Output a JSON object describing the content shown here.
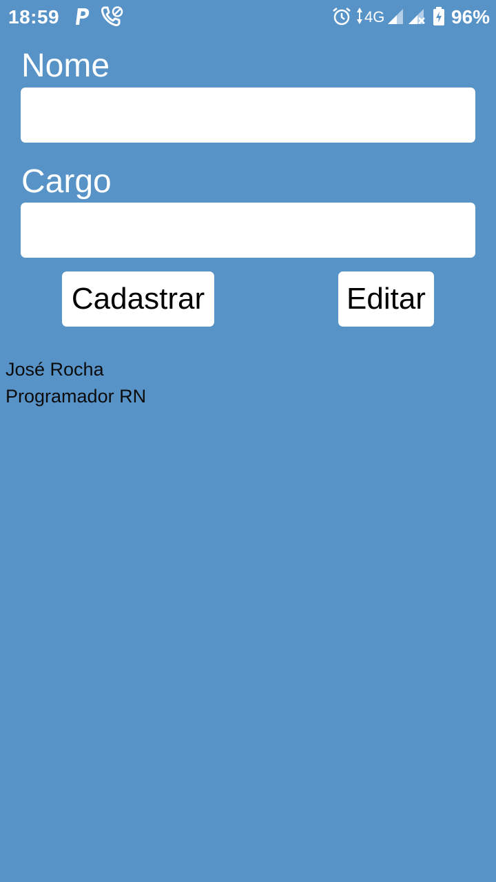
{
  "status_bar": {
    "time": "18:59",
    "network_type": "4G",
    "battery_percent": "96%",
    "icons": [
      "parking-p-icon",
      "call-blocked-icon",
      "alarm-icon",
      "data-arrows-icon",
      "signal-icon",
      "signal-no-sim-icon",
      "battery-charging-icon"
    ]
  },
  "form": {
    "name_label": "Nome",
    "name_value": "",
    "role_label": "Cargo",
    "role_value": ""
  },
  "actions": {
    "register_label": "Cadastrar",
    "edit_label": "Editar"
  },
  "records": [
    {
      "name": "José Rocha",
      "role": "Programador RN"
    }
  ],
  "colors": {
    "background": "#5893c8",
    "input_background": "#ffffff",
    "label_text": "#ffffff",
    "record_text": "#0b0b0b"
  }
}
